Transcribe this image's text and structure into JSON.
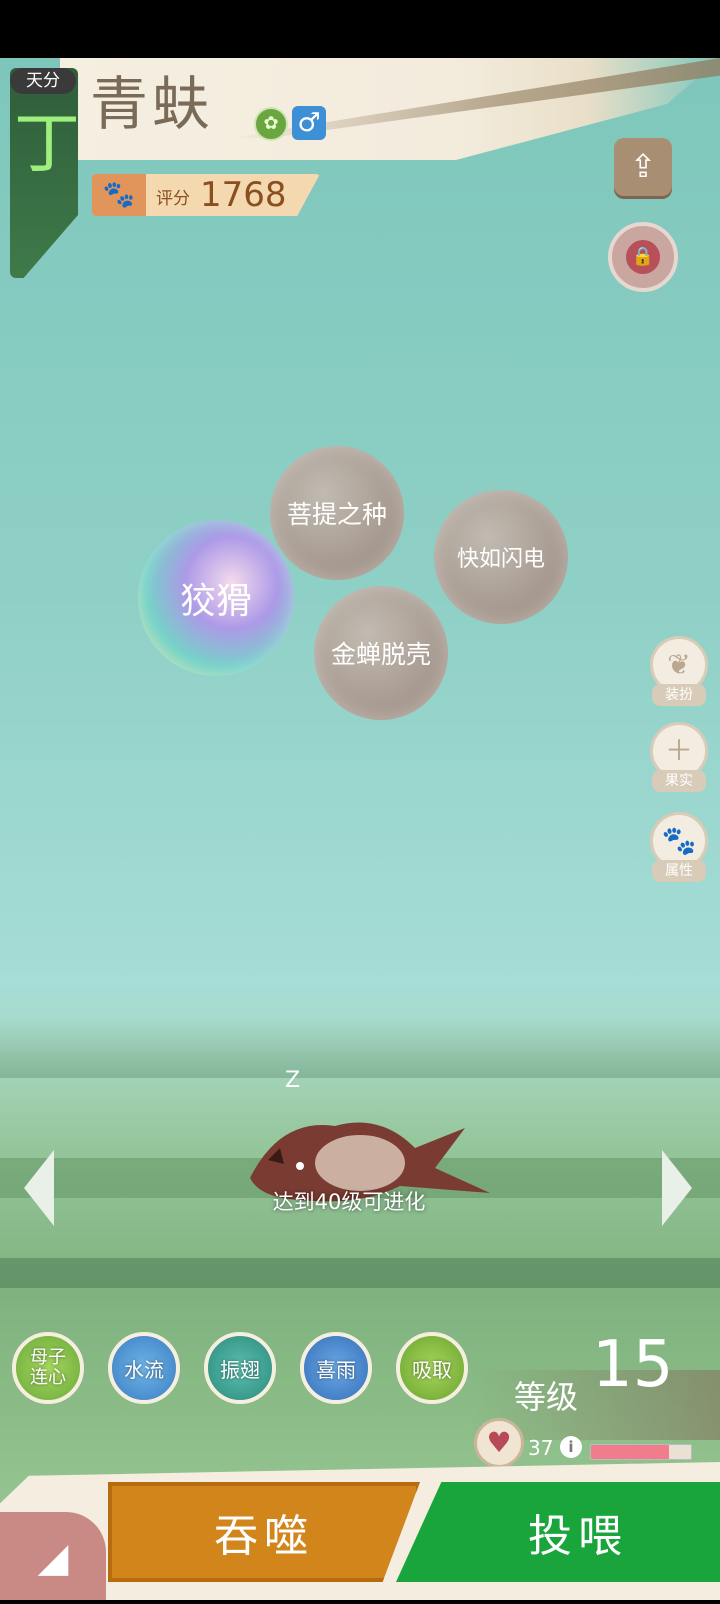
{
  "header": {
    "rank_tag": "天分",
    "rank_letter": "丁",
    "pet_name": "青蚨",
    "element_icon": "leaf-element-icon",
    "gender_symbol": "♂",
    "score_label": "评分",
    "score_value": "1768"
  },
  "top_buttons": {
    "share_icon": "share-icon",
    "lock_icon": "lock-icon"
  },
  "bubbles": [
    {
      "label": "狡猾",
      "special": true
    },
    {
      "label": "菩提之种"
    },
    {
      "label": "快如闪电"
    },
    {
      "label": "金蝉脱壳"
    }
  ],
  "side_menu": [
    {
      "icon": "butterfly-icon",
      "label": "装扮"
    },
    {
      "icon": "plus-icon",
      "label": "果实"
    },
    {
      "icon": "paw-icon",
      "label": "属性"
    }
  ],
  "creature": {
    "sleep_mark": "Z",
    "evolve_hint": "达到40级可进化"
  },
  "skills": [
    {
      "label": "母子连心",
      "color": "#8cc84b"
    },
    {
      "label": "水流",
      "color": "#3f8fd0"
    },
    {
      "label": "振翅",
      "color": "#2f9c8c"
    },
    {
      "label": "喜雨",
      "color": "#3f82c8"
    },
    {
      "label": "吸取",
      "color": "#7fbe3a"
    }
  ],
  "level": {
    "label": "等级",
    "value": "15"
  },
  "status": {
    "hunger_value": "37",
    "hunger_fraction": 0.78,
    "heart_icon": "heart-icon"
  },
  "actions": {
    "devour": "吞噬",
    "feed": "投喂",
    "corner_icon": "logo-icon"
  }
}
